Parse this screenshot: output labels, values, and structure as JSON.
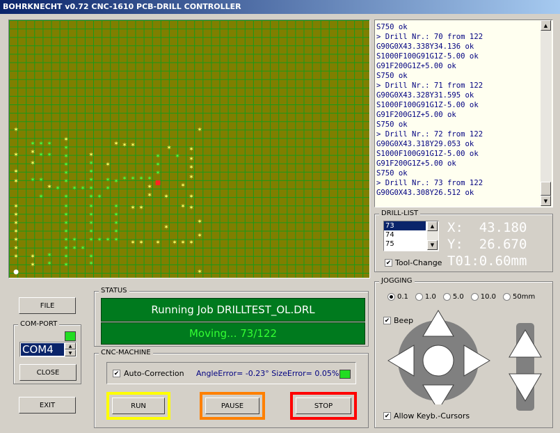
{
  "window": {
    "title": "BOHRKNECHT v0.72  CNC-1610 PCB-DRILL CONTROLLER"
  },
  "console": {
    "lines": [
      "S750 ok",
      "> Drill Nr.: 70 from 122",
      "G90G0X43.338Y34.136 ok",
      "S1000F100G91G1Z-5.00 ok",
      "G91F200G1Z+5.00 ok",
      "S750 ok",
      "> Drill Nr.: 71 from 122",
      "G90G0X43.328Y31.595 ok",
      "S1000F100G91G1Z-5.00 ok",
      "G91F200G1Z+5.00 ok",
      "S750 ok",
      "> Drill Nr.: 72 from 122",
      "G90G0X43.318Y29.053 ok",
      "S1000F100G91G1Z-5.00 ok",
      "G91F200G1Z+5.00 ok",
      "S750 ok",
      "> Drill Nr.: 73 from 122",
      "G90G0X43.308Y26.512 ok"
    ]
  },
  "drill_list": {
    "label": "DRILL-LIST",
    "items": [
      "73",
      "74",
      "75"
    ],
    "selected": "73",
    "tool_change_label": "Tool-Change",
    "tool_change_checked": true
  },
  "coords": {
    "x": "X:  43.180",
    "y": "Y:  26.670",
    "tool": "T01:0.60mm"
  },
  "left": {
    "file_label": "FILE",
    "comport_label": "COM-PORT",
    "port": "COM4",
    "close_label": "CLOSE",
    "exit_label": "EXIT",
    "led_color": "#22dd22"
  },
  "status": {
    "label": "STATUS",
    "job_text": "Running Job DRILLTEST_OL.DRL",
    "progress_text": "Moving... 73/122",
    "job_text_color": "#ffffff",
    "progress_text_color": "#33ff33",
    "bg": "#007a1e"
  },
  "cnc": {
    "label": "CNC-MACHINE",
    "autocorr_label": "Auto-Correction",
    "autocorr_checked": true,
    "error_text": "AngleError= -0.23° SizeError= 0.05%",
    "run_label": "RUN",
    "pause_label": "PAUSE",
    "stop_label": "STOP",
    "run_color": "#ffff00",
    "pause_color": "#ff8000",
    "stop_color": "#ff0000"
  },
  "jogging": {
    "label": "JOGGING",
    "steps": [
      "0.1",
      "1.0",
      "5.0",
      "10.0",
      "50mm"
    ],
    "selected_step": "0.1",
    "beep_label": "Beep",
    "beep_checked": true,
    "allow_keys_label": "Allow Keyb.-Cursors",
    "allow_keys_checked": true
  },
  "board": {
    "bg": "#7f7f00",
    "grid_color": "#1a9a1a",
    "marker_colors": {
      "yellow": "#ffff66",
      "green": "#44ff44",
      "red": "#ff2222",
      "white": "#ffffff"
    }
  }
}
